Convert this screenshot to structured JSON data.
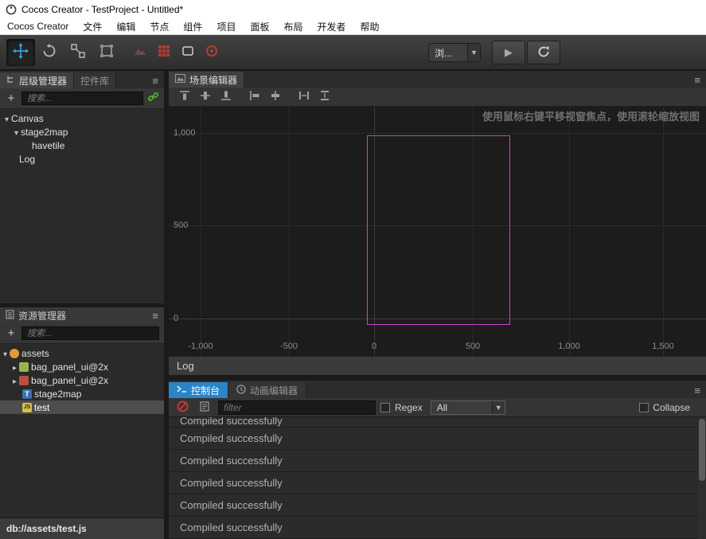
{
  "window": {
    "title": "Cocos Creator - TestProject - Untitled*"
  },
  "menu": {
    "items": [
      "Cocos Creator",
      "文件",
      "编辑",
      "节点",
      "组件",
      "项目",
      "面板",
      "布局",
      "开发者",
      "帮助"
    ]
  },
  "toolbar": {
    "preview_target": "浏..."
  },
  "hierarchy": {
    "tabs": [
      {
        "label": "层级管理器"
      },
      {
        "label": "控件库"
      }
    ],
    "add_label": "+",
    "search_placeholder": "搜索...",
    "nodes": [
      {
        "label": "Canvas",
        "depth": 0,
        "expanded": true
      },
      {
        "label": "stage2map",
        "depth": 1,
        "expanded": true
      },
      {
        "label": "havetile",
        "depth": 2
      },
      {
        "label": "Log",
        "depth": 0
      }
    ]
  },
  "assets": {
    "title": "资源管理器",
    "add_label": "+",
    "search_placeholder": "搜索...",
    "items": [
      {
        "label": "assets",
        "icon": "db-root-folder",
        "expanded": true
      },
      {
        "label": "bag_panel_ui@2x",
        "icon": "atlas-asset",
        "collapsed": true
      },
      {
        "label": "bag_panel_ui@2x",
        "icon": "image-asset",
        "collapsed": true
      },
      {
        "label": "stage2map",
        "icon": "tilemap-asset",
        "icon_text": "T"
      },
      {
        "label": "test",
        "icon": "javascript-asset",
        "icon_text": "JS",
        "selected": true
      }
    ],
    "status_path": "db://assets/test.js"
  },
  "scene": {
    "tab_label": "场景编辑器",
    "hint": "使用鼠标右键平移视窗焦点，使用滚轮缩放视图",
    "x_labels": [
      "-1,000",
      "-500",
      "0",
      "500",
      "1,000",
      "1,500"
    ],
    "y_labels": [
      "1,000",
      "500",
      "0"
    ]
  },
  "log_bar": {
    "label": "Log"
  },
  "console": {
    "tabs": [
      {
        "label": "控制台"
      },
      {
        "label": "动画编辑器"
      }
    ],
    "filter_placeholder": "filter",
    "regex_label": "Regex",
    "level_filter_value": "All",
    "collapse_label": "Collapse",
    "entries": [
      "Compiled successfully",
      "Compiled successfully",
      "Compiled successfully",
      "Compiled successfully",
      "Compiled successfully",
      "Compiled successfully"
    ]
  },
  "colors": {
    "console_active_tab_blue": "#2a84c9",
    "design_rect_magenta": "#cf3fcf",
    "clear_button_red": "#c63636",
    "link_icon_green": "#57b32c"
  }
}
